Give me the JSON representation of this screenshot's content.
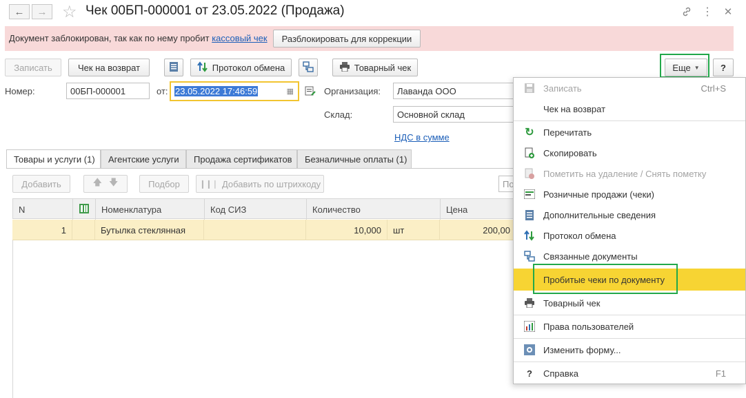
{
  "window": {
    "title": "Чек 00БП-000001 от 23.05.2022 (Продажа)"
  },
  "banner": {
    "text": "Документ заблокирован, так как по нему пробит ",
    "link": "кассовый чек",
    "unlock_button": "Разблокировать для коррекции"
  },
  "toolbar": {
    "save": "Записать",
    "return_check": "Чек на возврат",
    "exchange_protocol": "Протокол обмена",
    "goods_check": "Товарный чек",
    "more": "Еще",
    "help": "?"
  },
  "form": {
    "number_label": "Номер:",
    "number_value": "00БП-000001",
    "date_label": "от:",
    "date_value": "23.05.2022 17:46:59",
    "org_label": "Организация:",
    "org_value": "Лаванда ООО",
    "warehouse_label": "Склад:",
    "warehouse_value": "Основной склад",
    "vat_link": "НДС в сумме"
  },
  "tabs": [
    {
      "label": "Товары и услуги (1)"
    },
    {
      "label": "Агентские услуги"
    },
    {
      "label": "Продажа сертификатов"
    },
    {
      "label": "Безналичные оплаты (1)"
    }
  ],
  "table_toolbar": {
    "add": "Добавить",
    "selection": "Подбор",
    "add_by_barcode": "Добавить по штрихкоду",
    "search_partial": "По"
  },
  "table": {
    "columns": [
      "N",
      "",
      "Номенклатура",
      "Код СИЗ",
      "Количество",
      "Цена"
    ],
    "rows": [
      {
        "n": "1",
        "item": "Бутылка стеклянная",
        "code": "",
        "qty": "10,000",
        "unit": "шт",
        "price": "200,00"
      }
    ]
  },
  "menu": {
    "items": [
      {
        "label": "Записать",
        "shortcut": "Ctrl+S",
        "icon": "save-icon",
        "disabled": true
      },
      {
        "label": "Чек на возврат",
        "shortcut": "",
        "icon": "",
        "disabled": false
      },
      {
        "label": "Перечитать",
        "shortcut": "",
        "icon": "refresh-icon",
        "disabled": false
      },
      {
        "label": "Скопировать",
        "shortcut": "",
        "icon": "copy-icon",
        "disabled": false
      },
      {
        "label": "Пометить на удаление / Снять пометку",
        "shortcut": "",
        "icon": "delete-mark-icon",
        "disabled": true
      },
      {
        "label": "Розничные продажи (чеки)",
        "shortcut": "",
        "icon": "retail-sales-icon",
        "disabled": false
      },
      {
        "label": "Дополнительные сведения",
        "shortcut": "",
        "icon": "details-icon",
        "disabled": false
      },
      {
        "label": "Протокол обмена",
        "shortcut": "",
        "icon": "exchange-icon",
        "disabled": false
      },
      {
        "label": "Связанные документы",
        "shortcut": "",
        "icon": "linked-docs-icon",
        "disabled": false
      },
      {
        "label": "Пробитые чеки по документу",
        "shortcut": "",
        "icon": "",
        "disabled": false
      },
      {
        "label": "Товарный чек",
        "shortcut": "",
        "icon": "printer-icon",
        "disabled": false
      },
      {
        "label": "Права пользователей",
        "shortcut": "",
        "icon": "user-rights-icon",
        "disabled": false
      },
      {
        "label": "Изменить форму...",
        "shortcut": "",
        "icon": "change-form-icon",
        "disabled": false
      },
      {
        "label": "Справка",
        "shortcut": "F1",
        "icon": "help-icon",
        "disabled": false
      }
    ]
  },
  "colors": {
    "highlight": "#f7d433",
    "annotation": "#22a84a",
    "banner": "#f8d9d9",
    "link": "#1b5eb8"
  }
}
